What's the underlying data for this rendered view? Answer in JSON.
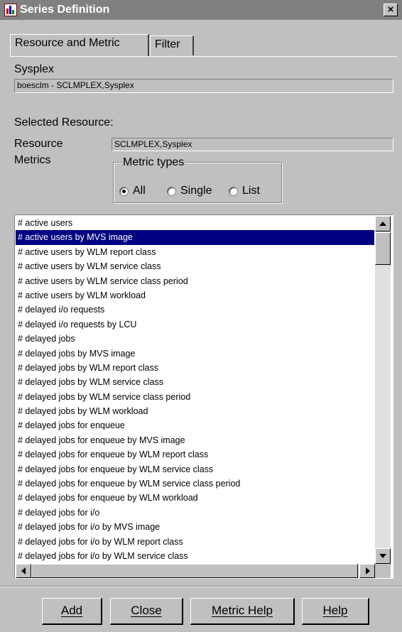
{
  "window": {
    "title": "Series Definition",
    "close_glyph": "×"
  },
  "tabs": [
    "Resource and Metric",
    "Filter"
  ],
  "sysplex": {
    "label": "Sysplex",
    "value": "boesclm - SCLMPLEX,Sysplex"
  },
  "selected_resource": {
    "heading": "Selected Resource:",
    "resource_label": "Resource",
    "resource_value": "SCLMPLEX,Sysplex",
    "metrics_label": "Metrics"
  },
  "metric_types": {
    "legend": "Metric types",
    "options": [
      {
        "label": "All",
        "selected": true
      },
      {
        "label": "Single",
        "selected": false
      },
      {
        "label": "List",
        "selected": false
      }
    ]
  },
  "metrics_list": {
    "selected_index": 1,
    "items": [
      "# active users",
      "# active users by MVS image",
      "# active users by WLM report class",
      "# active users by WLM service class",
      "# active users by WLM service class period",
      "# active users by WLM workload",
      "# delayed i/o requests",
      "# delayed i/o requests by LCU",
      "# delayed jobs",
      "# delayed jobs by MVS image",
      "# delayed jobs by WLM report class",
      "# delayed jobs by WLM service class",
      "# delayed jobs by WLM service class period",
      "# delayed jobs by WLM workload",
      "# delayed jobs for enqueue",
      "# delayed jobs for enqueue by MVS image",
      "# delayed jobs for enqueue by WLM report class",
      "# delayed jobs for enqueue by WLM service class",
      "# delayed jobs for enqueue by WLM service class period",
      "# delayed jobs for enqueue by WLM workload",
      "# delayed jobs for i/o",
      "# delayed jobs for i/o by MVS image",
      "# delayed jobs for i/o by WLM report class",
      "# delayed jobs for i/o by WLM service class"
    ]
  },
  "buttons": {
    "add": "Add",
    "close": "Close",
    "metric_help": "Metric Help",
    "help": "Help"
  },
  "colors": {
    "selection": "#000080",
    "titlebar": "#808080",
    "face": "#c0c0c0"
  }
}
